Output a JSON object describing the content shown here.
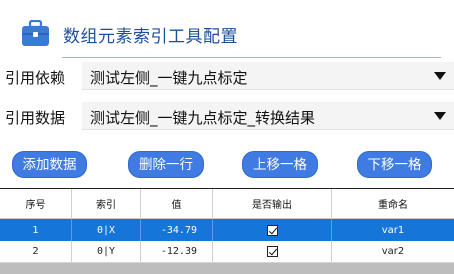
{
  "header": {
    "title": "数组元素索引工具配置",
    "icon": "briefcase-icon",
    "accent_color": "#1b4f9c"
  },
  "fields": [
    {
      "label": "引用依赖",
      "value": "测试左侧_一键九点标定"
    },
    {
      "label": "引用数据",
      "value": "测试左侧_一键九点标定_转换结果"
    }
  ],
  "buttons": {
    "add": "添加数据",
    "delete": "删除一行",
    "move_up": "上移一格",
    "move_down": "下移一格",
    "color": "#3f7be3"
  },
  "table": {
    "columns": [
      "序号",
      "索引",
      "值",
      "是否输出",
      "重命名"
    ],
    "rows": [
      {
        "index": "1",
        "key": "0|X",
        "value": "-34.79",
        "output": true,
        "rename": "var1",
        "selected": true
      },
      {
        "index": "2",
        "key": "0|Y",
        "value": "-12.39",
        "output": true,
        "rename": "var2",
        "selected": false
      }
    ],
    "selected_color": "#1675d8"
  }
}
